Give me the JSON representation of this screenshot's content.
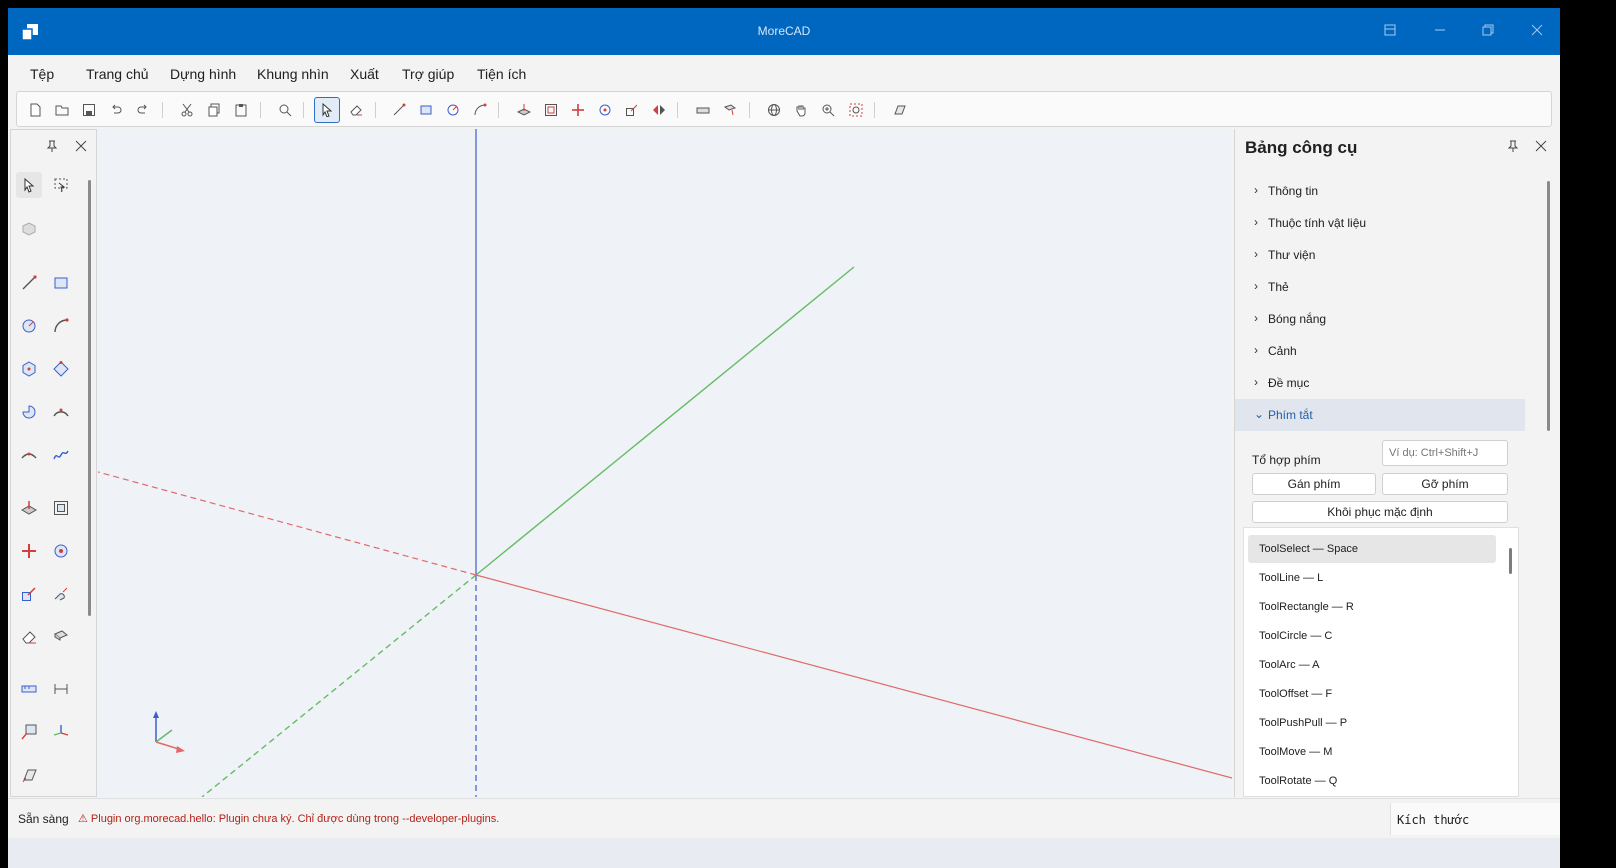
{
  "window": {
    "title": "MoreCAD",
    "icons": [
      "app-logo-icon",
      "pin-icon",
      "minimize-icon",
      "restore-icon",
      "close-icon"
    ]
  },
  "menu": {
    "items": [
      "Tệp",
      "Trang chủ",
      "Dựng hình",
      "Khung nhìn",
      "Xuất",
      "Trợ giúp",
      "Tiện ích"
    ]
  },
  "toolbar": {
    "active_tool": "select",
    "icons": [
      "new-file-icon",
      "open-folder-icon",
      "save-icon",
      "undo-icon",
      "redo-icon",
      "cut-icon",
      "copy-icon",
      "paste-icon",
      "zoom-extents-icon",
      "select-icon",
      "eraser-icon",
      "line-icon",
      "rectangle-icon",
      "circle-icon",
      "arc-icon",
      "push-pull-icon",
      "offset-icon",
      "move-icon",
      "rotate-icon",
      "scale-icon",
      "flip-icon",
      "tape-measure-icon",
      "paint-bucket-icon",
      "orbit-icon",
      "pan-icon",
      "zoom-icon",
      "zoom-window-icon",
      "section-plane-icon"
    ]
  },
  "palette": {
    "icons": [
      "select-icon",
      "lasso-select-icon",
      "component-icon",
      "line-icon",
      "rectangle-icon",
      "circle-icon",
      "arc-icon",
      "polygon-icon",
      "rotated-rectangle-icon",
      "pie-icon",
      "three-point-arc-icon",
      "two-point-arc-icon",
      "freehand-icon",
      "push-pull-icon",
      "offset-icon",
      "move-icon",
      "rotate-icon",
      "scale-icon",
      "follow-me-icon",
      "eraser-icon",
      "paint-bucket-icon",
      "tape-measure-icon",
      "dimension-icon",
      "text-icon",
      "axes-icon",
      "section-plane-icon"
    ]
  },
  "panel": {
    "title": "Bảng công cụ",
    "sections": [
      {
        "label": "Thông tin",
        "expanded": false
      },
      {
        "label": "Thuộc tính vật liệu",
        "expanded": false
      },
      {
        "label": "Thư viện",
        "expanded": false
      },
      {
        "label": "Thẻ",
        "expanded": false
      },
      {
        "label": "Bóng nắng",
        "expanded": false
      },
      {
        "label": "Cảnh",
        "expanded": false
      },
      {
        "label": "Đề mục",
        "expanded": false
      },
      {
        "label": "Phím tắt",
        "expanded": true
      }
    ],
    "shortcuts": {
      "combo_label": "Tổ hợp phím",
      "combo_placeholder": "Ví dụ: Ctrl+Shift+J",
      "assign_button": "Gán phím",
      "remove_button": "Gỡ phím",
      "reset_button": "Khôi phục mặc định",
      "selected_index": 0,
      "items": [
        "ToolSelect — Space",
        "ToolLine — L",
        "ToolRectangle — R",
        "ToolCircle — C",
        "ToolArc — A",
        "ToolOffset — F",
        "ToolPushPull — P",
        "ToolMove — M",
        "ToolRotate — Q"
      ]
    }
  },
  "status": {
    "ready": "Sẵn sàng",
    "warning": "⚠ Plugin org.morecad.hello: Plugin chưa ký. Chỉ được dùng trong --developer-plugins.",
    "dimension_label": "Kích thước"
  },
  "axes_colors": {
    "x": "#e06a6a",
    "y": "#66bb66",
    "z": "#3a5fcd"
  }
}
